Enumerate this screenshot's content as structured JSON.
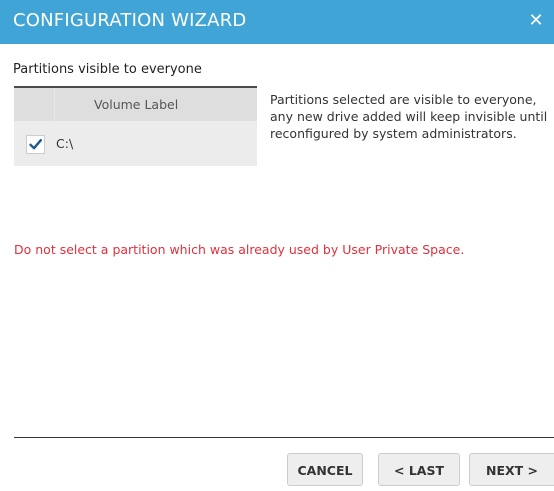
{
  "window": {
    "title": "CONFIGURATION WIZARD",
    "close_glyph": "✕"
  },
  "section": {
    "label": "Partitions visible to everyone"
  },
  "partition_table": {
    "column_header": "Volume Label",
    "rows": [
      {
        "label": "C:\\",
        "checked": true
      }
    ]
  },
  "info": {
    "text": "Partitions selected are visible to everyone, any new drive added will keep invisible until reconfigured by system administrators."
  },
  "warning": {
    "text": "Do not select a partition which was already used by User Private Space."
  },
  "footer": {
    "cancel_label": "CANCEL",
    "last_label": "< LAST",
    "next_label": "NEXT >"
  },
  "colors": {
    "titlebar": "#40a5d6",
    "warning": "#e0303c",
    "checkmark": "#1e5a8e"
  }
}
